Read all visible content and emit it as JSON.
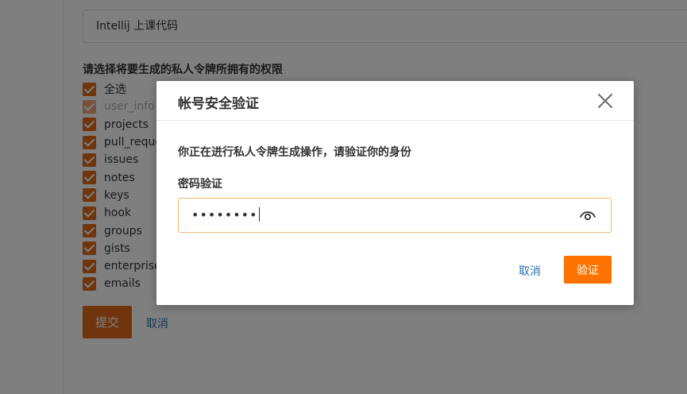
{
  "background": {
    "description_value": "Intellij 上课代码",
    "permissions_title": "请选择将要生成的私人令牌所拥有的权限",
    "permissions": [
      {
        "label": "全选",
        "disabled": false
      },
      {
        "label": "user_info",
        "disabled": true
      },
      {
        "label": "projects",
        "disabled": false
      },
      {
        "label": "pull_requests",
        "disabled": false
      },
      {
        "label": "issues",
        "disabled": false
      },
      {
        "label": "notes",
        "disabled": false
      },
      {
        "label": "keys",
        "disabled": false
      },
      {
        "label": "hook",
        "disabled": false
      },
      {
        "label": "groups",
        "disabled": false
      },
      {
        "label": "gists",
        "disabled": false
      },
      {
        "label": "enterprises",
        "disabled": false
      },
      {
        "label": "emails",
        "disabled": false
      }
    ],
    "submit_label": "提交",
    "cancel_label": "取消"
  },
  "modal": {
    "title": "帐号安全验证",
    "description": "你正在进行私人令牌生成操作，请验证你的身份",
    "password_label": "密码验证",
    "password_value": "••••••••",
    "cancel_label": "取消",
    "confirm_label": "验证"
  },
  "colors": {
    "accent": "#fe7300",
    "checkbox": "#e06a1a",
    "link": "#2a6fb0"
  }
}
